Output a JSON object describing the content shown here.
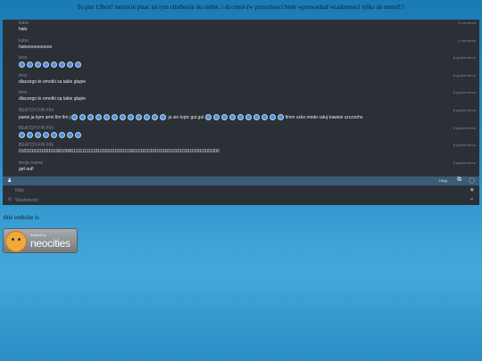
{
  "banner": "To jest 13box! mozecie pisac na tym chatboxie do siebie, i do mnie (w przyszlosci bede wprowadzal wiadomosci tylko do mnie)!!!",
  "messages": [
    {
      "nick": "kuba",
      "time": "5 min temu",
      "text": "halo",
      "emotes": 0
    },
    {
      "nick": "kuba",
      "time": "5 min temu",
      "text": "halooooooooooo",
      "emotes": 0
    },
    {
      "nick": "lenn",
      "time": "8 godzin temu",
      "text": "",
      "emotes": 8
    },
    {
      "nick": "lenn",
      "time": "8 godzin temu",
      "text": "dlaczego te emotki sa takie glupie",
      "emotes": 0
    },
    {
      "nick": "lenn",
      "time": "8 godzin temu",
      "text": "dlaczego te emotki są takie glupie",
      "emotes": 0
    },
    {
      "nick": "BEATCH FIN FIN",
      "time": "8 godzin temu",
      "text": "",
      "emotes": 0,
      "special": true
    },
    {
      "nick": "BEATCH FIN FIN",
      "time": "8 godzin temu",
      "text": "",
      "emotes": 8
    },
    {
      "nick": "BEATCH FIN FIN",
      "time": "8 godzin temu",
      "text": "0101010101001010010000111111111101010101010101001010101010101010101010101010101000",
      "emotes": 0
    },
    {
      "nick": "twoja mama",
      "time": "8 godzin temu",
      "text": "get out!",
      "emotes": 0
    }
  ],
  "special_message": {
    "part1": "panie ja bym armi fim fim j",
    "emotes1": 12,
    "part2": "ja sie topic gul gul",
    "emotes2": 10,
    "part3": "fimm szko mode ratuj trawise szczocho"
  },
  "toolbar": {
    "send_label": "Ukryj"
  },
  "nick_field": {
    "placeholder": "Nick"
  },
  "message_field": {
    "placeholder": "Wiadomość"
  },
  "footer_text": "this website is",
  "neocities": {
    "hosted": "hosted by",
    "brand": "neocities"
  }
}
